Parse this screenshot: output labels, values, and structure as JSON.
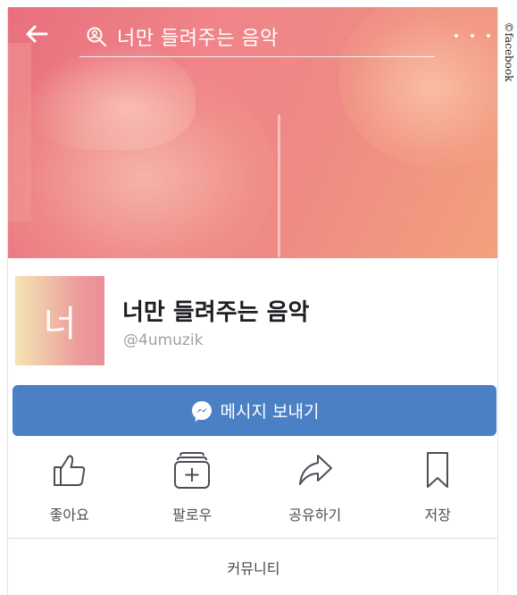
{
  "header": {
    "search_text": "너만 들려주는 음악",
    "back_icon": "arrow-left-icon",
    "search_icon": "search-icon",
    "more_icon": "more-dots-icon"
  },
  "profile": {
    "avatar_letter": "너",
    "name": "너만 들려주는 음악",
    "handle": "@4umuzik"
  },
  "message_button": {
    "label": "메시지 보내기",
    "icon": "messenger-icon",
    "color": "#4c80c4"
  },
  "actions": [
    {
      "label": "좋아요",
      "icon": "thumbs-up-icon"
    },
    {
      "label": "팔로우",
      "icon": "follow-icon"
    },
    {
      "label": "공유하기",
      "icon": "share-icon"
    },
    {
      "label": "저장",
      "icon": "bookmark-icon"
    }
  ],
  "tabs": {
    "community": "커뮤니티"
  },
  "credit": "©facebook"
}
